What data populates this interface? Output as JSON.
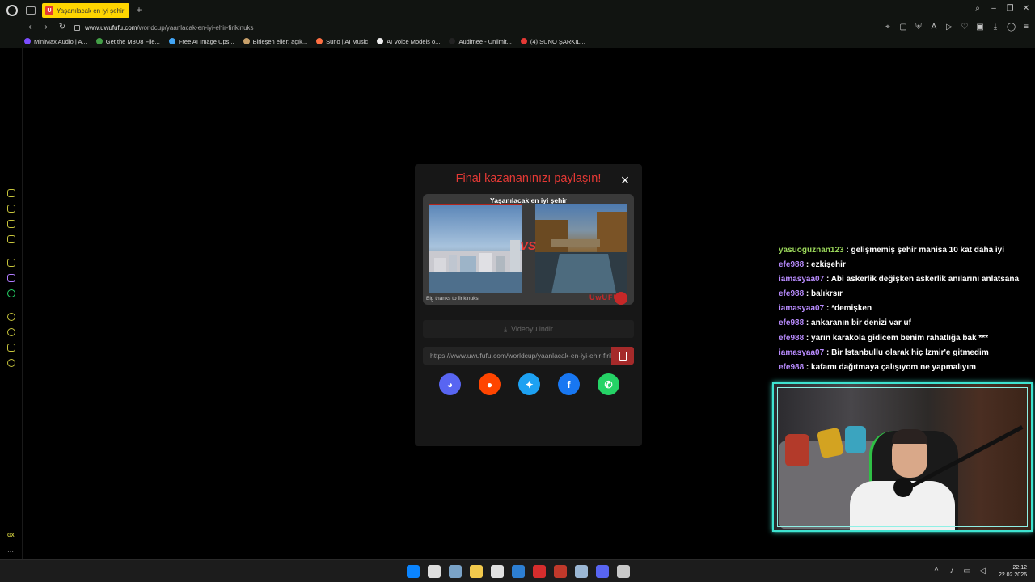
{
  "browser": {
    "tab_favicon": "U",
    "tab_title": "Yaşanılacak en iyi şehir | U",
    "add_tab": "+",
    "url_host": "www.uwufufu.com",
    "url_path": "/worldcup/yaanlacak-en-iyi-ehir-firikinuks",
    "bookmarks": [
      {
        "label": "MiniMax Audio | A...",
        "color": "#7c4dff"
      },
      {
        "label": "Get the M3U8 File...",
        "color": "#43a047"
      },
      {
        "label": "Free AI Image Ups...",
        "color": "#42a5f5"
      },
      {
        "label": "Birleşen eller: açık...",
        "color": "#c8a06a"
      },
      {
        "label": "Suno | AI Music",
        "color": "#ff7043"
      },
      {
        "label": "AI Voice Models o...",
        "color": "#eeeeee"
      },
      {
        "label": "Audimee - Unlimit...",
        "color": "#222222"
      },
      {
        "label": "(4) SUNO ŞARKIL...",
        "color": "#e53935"
      }
    ]
  },
  "modal": {
    "title": "Final kazananınızı paylaşın!",
    "close": "×",
    "card_title": "Yaşanılacak en iyi şehir",
    "vs": "VS",
    "credit": "Big thanks to firikinuks",
    "brand": "UwUFU",
    "download_label": "Videoyu indir",
    "share_url": "https://www.uwufufu.com/worldcup/yaanlacak-en-iyi-ehir-firikinuks",
    "socials": [
      {
        "name": "discord",
        "glyph": "◕",
        "color": "#5865f2"
      },
      {
        "name": "reddit",
        "glyph": "●",
        "color": "#ff4500"
      },
      {
        "name": "twitter",
        "glyph": "✦",
        "color": "#1da1f2"
      },
      {
        "name": "facebook",
        "glyph": "f",
        "color": "#1877f2"
      },
      {
        "name": "whatsapp",
        "glyph": "✆",
        "color": "#25d366"
      }
    ]
  },
  "chat": [
    {
      "user": "yasuoguznan123",
      "text": "gelişmemiş şehir manisa 10 kat daha iyi",
      "user_color": "#9ad65a"
    },
    {
      "user": "efe988",
      "text": "ezkişehir",
      "user_color": "#b98cff"
    },
    {
      "user": "iamasyaa07",
      "text": "Abi askerlik değişken askerlik anılarını anlatsana",
      "user_color": "#b98cff"
    },
    {
      "user": "efe988",
      "text": "balıkrsır",
      "user_color": "#b98cff"
    },
    {
      "user": "iamasyaa07",
      "text": "*demişken",
      "user_color": "#b98cff"
    },
    {
      "user": "efe988",
      "text": "ankaranın bir denizi var uf",
      "user_color": "#b98cff"
    },
    {
      "user": "efe988",
      "text": "yarın karakola gidicem benim rahatlığa bak ***",
      "user_color": "#b98cff"
    },
    {
      "user": "iamasyaa07",
      "text": "Bir İstanbullu olarak hiç İzmir'e gitmedim",
      "user_color": "#b98cff"
    },
    {
      "user": "efe988",
      "text": "kafamı dağıtmaya çalışıyom ne yapmalıyım",
      "user_color": "#b98cff"
    }
  ],
  "sidebar": {
    "gx_label": "GX",
    "more": "···"
  },
  "taskbar": {
    "time": "22:12",
    "date": "22.02.2026",
    "apps": [
      "#0a84ff",
      "#dddddd",
      "#7aa3c8",
      "#f2c94c",
      "#e0e0e0",
      "#2d7fd3",
      "#d62d2d",
      "#c0392b",
      "#9bb7d4",
      "#5865f2",
      "#c8c8c8"
    ]
  }
}
